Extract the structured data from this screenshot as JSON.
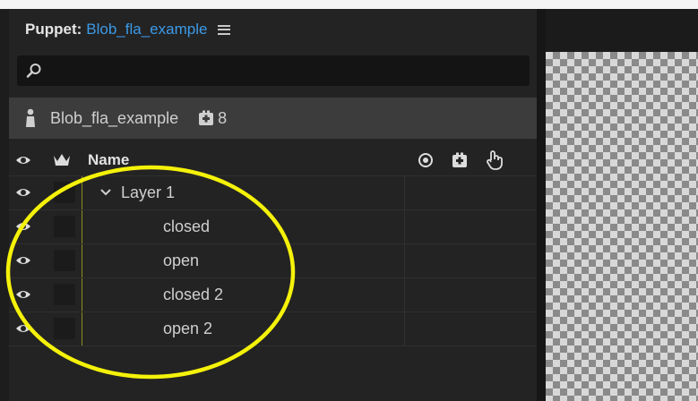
{
  "title": {
    "label": "Puppet:",
    "name": "Blob_fla_example"
  },
  "search": {
    "placeholder": ""
  },
  "puppet_info": {
    "name": "Blob_fla_example",
    "handle_count": "8"
  },
  "columns": {
    "name": "Name"
  },
  "layers": [
    {
      "label": "Layer 1",
      "expanded": true
    },
    {
      "label": "closed"
    },
    {
      "label": "open"
    },
    {
      "label": "closed 2"
    },
    {
      "label": "open 2"
    }
  ],
  "colors": {
    "accent": "#3b9ae8",
    "annotation": "#f5f20a",
    "layer_line": "#8b8f1c"
  },
  "icons": [
    "hamburger-icon",
    "search-icon",
    "puppet-icon",
    "handle-icon",
    "eye-icon",
    "crown-icon",
    "tag-icon",
    "hand-icon",
    "chevron-down-icon"
  ]
}
